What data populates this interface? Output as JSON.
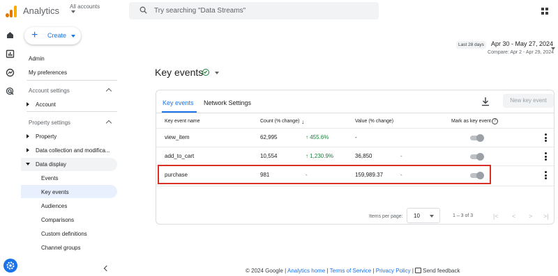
{
  "topbar": {
    "app_title": "Analytics",
    "account_label": "All accounts",
    "search_placeholder": "Try searching \"Data Streams\""
  },
  "nav": {
    "create_label": "Create",
    "admin": "Admin",
    "my_preferences": "My preferences",
    "account_settings": "Account settings",
    "account": "Account",
    "property_settings": "Property settings",
    "property": "Property",
    "data_collection": "Data collection and modifica...",
    "data_display": "Data display",
    "sub_items": [
      "Events",
      "Key events",
      "Audiences",
      "Comparisons",
      "Custom definitions",
      "Channel groups"
    ]
  },
  "date_range": {
    "pill": "Last 28 days",
    "range": "Apr 30 - May 27, 2024",
    "compare": "Compare: Apr 2 - Apr 29, 2024"
  },
  "page": {
    "title": "Key events"
  },
  "tabs": [
    "Key events",
    "Network Settings"
  ],
  "new_key_event_label": "New key event",
  "table": {
    "headers": {
      "name": "Key event name",
      "count": "Count (% change)",
      "value": "Value (% change)",
      "mark": "Mark as key event"
    },
    "rows": [
      {
        "name": "view_item",
        "count": "62,995",
        "count_change": "455.6%",
        "count_dir": "up",
        "value": "-",
        "value_change": ""
      },
      {
        "name": "add_to_cart",
        "count": "10,554",
        "count_change": "1,230.9%",
        "count_dir": "up",
        "value": "36,850",
        "value_change": "-"
      },
      {
        "name": "purchase",
        "count": "981",
        "count_change": "-",
        "count_dir": "none",
        "value": "159,989.37",
        "value_change": "-"
      }
    ]
  },
  "pagination": {
    "items_per_page_label": "Items per page:",
    "items_per_page": "10",
    "range": "1 – 3 of 3"
  },
  "footer": {
    "copyright": "© 2024 Google |",
    "analytics_home": "Analytics home",
    "sep1": "|",
    "terms": "Terms of Service",
    "sep2": "|",
    "privacy": "Privacy Policy",
    "sep3": "|",
    "feedback": "Send feedback"
  },
  "colors": {
    "accent": "#1a73e8",
    "positive": "#188038",
    "highlight_border": "#d93025"
  }
}
